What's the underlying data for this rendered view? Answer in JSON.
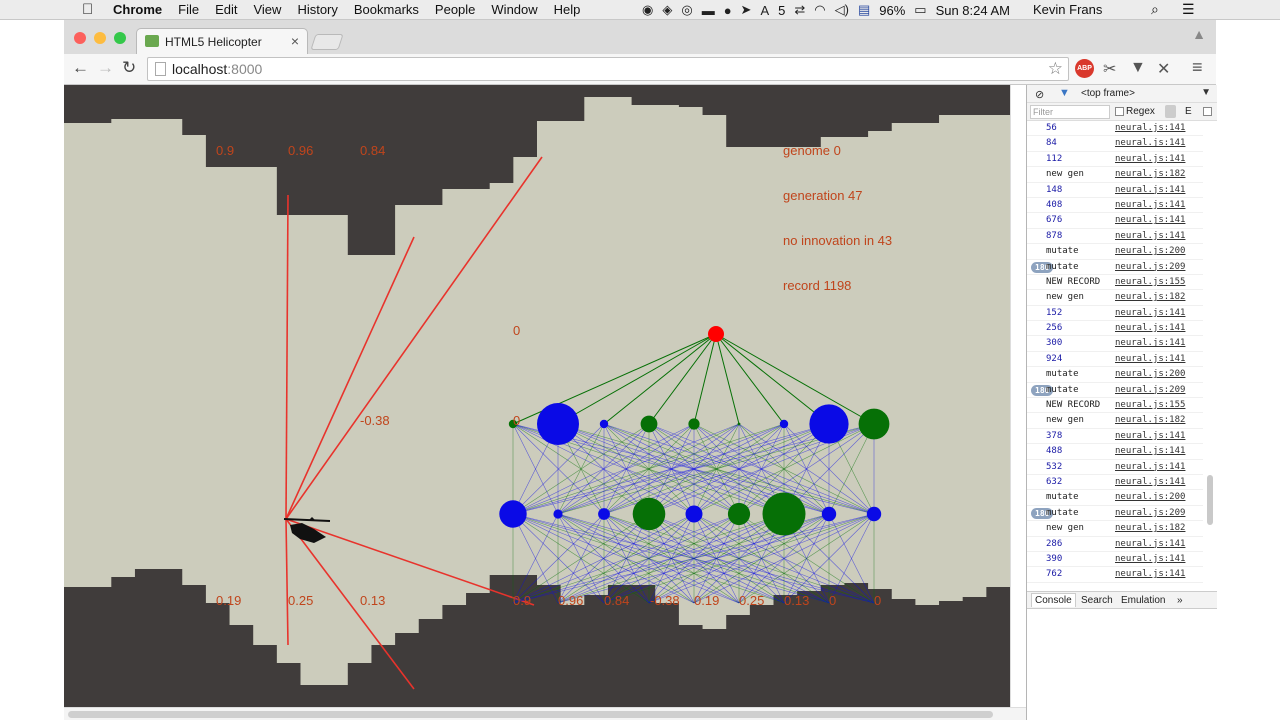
{
  "menubar": {
    "apple": "",
    "app_name": "Chrome",
    "menus": [
      "File",
      "Edit",
      "View",
      "History",
      "Bookmarks",
      "People",
      "Window",
      "Help"
    ],
    "status_number": "5",
    "battery": "96%",
    "datetime": "Sun 8:24 AM",
    "user": "Kevin Frans"
  },
  "tab": {
    "title": "HTML5 Helicopter",
    "close": "×"
  },
  "toolbar": {
    "back": "←",
    "forward": "→",
    "reload": "↻",
    "host": "localhost",
    "port": ":8000",
    "star": "☆",
    "abp": "ABP",
    "menu": "≡"
  },
  "game": {
    "hud": {
      "genome": "genome 0",
      "generation": "generation 47",
      "innovation": "no innovation in 43",
      "record": "record 1198",
      "output_label": "0",
      "hidden_label": "0",
      "ray_label": "-0.38"
    },
    "sensors_top": [
      "0.9",
      "0.96",
      "0.84"
    ],
    "sensors_bottom": [
      "0.19",
      "0.25",
      "0.13"
    ],
    "input_labels": [
      "0.9",
      "0.96",
      "0.84",
      "-0.38",
      "0.19",
      "0.25",
      "0.13",
      "0",
      "0"
    ],
    "colors": {
      "terrain": "#403c3b",
      "cave": "#ccccbc",
      "ray": "#e8332c",
      "output_node": "#ff0000",
      "positive_node": "#067006",
      "negative_node": "#0a0ae6",
      "text": "#c0451c"
    },
    "network": {
      "hidden_layer_sizes": [
        6,
        30,
        6,
        12,
        8,
        2,
        6,
        28,
        22
      ],
      "hidden_layer_signs": [
        "positive",
        "negative",
        "negative",
        "positive",
        "positive",
        "positive",
        "negative",
        "negative",
        "positive"
      ],
      "mid_layer_sizes": [
        18,
        4,
        6,
        22,
        10,
        14,
        30,
        8,
        8
      ],
      "mid_layer_signs": [
        "negative",
        "negative",
        "negative",
        "positive",
        "negative",
        "positive",
        "positive",
        "negative",
        "negative"
      ]
    }
  },
  "devtools": {
    "no_entry": "⊘",
    "filter_icon": "▼",
    "frame": "<top frame>",
    "frame_dd": "▼",
    "filter_placeholder": "Filter",
    "regex": "Regex",
    "e_label": "E",
    "rows": [
      {
        "msg": "56",
        "src": "neural.js:141",
        "type": "num"
      },
      {
        "msg": "84",
        "src": "neural.js:141",
        "type": "num"
      },
      {
        "msg": "112",
        "src": "neural.js:141",
        "type": "num"
      },
      {
        "msg": "new gen",
        "src": "neural.js:182",
        "type": "text"
      },
      {
        "msg": "148",
        "src": "neural.js:141",
        "type": "num"
      },
      {
        "msg": "408",
        "src": "neural.js:141",
        "type": "num"
      },
      {
        "msg": "676",
        "src": "neural.js:141",
        "type": "num"
      },
      {
        "msg": "878",
        "src": "neural.js:141",
        "type": "num"
      },
      {
        "msg": "mutate",
        "src": "neural.js:200",
        "type": "text"
      },
      {
        "msg": "mutate",
        "src": "neural.js:209",
        "type": "text",
        "badge": "180"
      },
      {
        "msg": "NEW RECORD",
        "src": "neural.js:155",
        "type": "text"
      },
      {
        "msg": "new gen",
        "src": "neural.js:182",
        "type": "text"
      },
      {
        "msg": "152",
        "src": "neural.js:141",
        "type": "num"
      },
      {
        "msg": "256",
        "src": "neural.js:141",
        "type": "num"
      },
      {
        "msg": "300",
        "src": "neural.js:141",
        "type": "num"
      },
      {
        "msg": "924",
        "src": "neural.js:141",
        "type": "num"
      },
      {
        "msg": "mutate",
        "src": "neural.js:200",
        "type": "text"
      },
      {
        "msg": "mutate",
        "src": "neural.js:209",
        "type": "text",
        "badge": "180"
      },
      {
        "msg": "NEW RECORD",
        "src": "neural.js:155",
        "type": "text"
      },
      {
        "msg": "new gen",
        "src": "neural.js:182",
        "type": "text"
      },
      {
        "msg": "378",
        "src": "neural.js:141",
        "type": "num"
      },
      {
        "msg": "488",
        "src": "neural.js:141",
        "type": "num"
      },
      {
        "msg": "532",
        "src": "neural.js:141",
        "type": "num"
      },
      {
        "msg": "632",
        "src": "neural.js:141",
        "type": "num"
      },
      {
        "msg": "mutate",
        "src": "neural.js:200",
        "type": "text"
      },
      {
        "msg": "mutate",
        "src": "neural.js:209",
        "type": "text",
        "badge": "180"
      },
      {
        "msg": "new gen",
        "src": "neural.js:182",
        "type": "text"
      },
      {
        "msg": "286",
        "src": "neural.js:141",
        "type": "num"
      },
      {
        "msg": "390",
        "src": "neural.js:141",
        "type": "num"
      },
      {
        "msg": "762",
        "src": "neural.js:141",
        "type": "num"
      }
    ],
    "drawer_tabs": [
      "Console",
      "Search",
      "Emulation"
    ],
    "drawer_more": "»"
  }
}
